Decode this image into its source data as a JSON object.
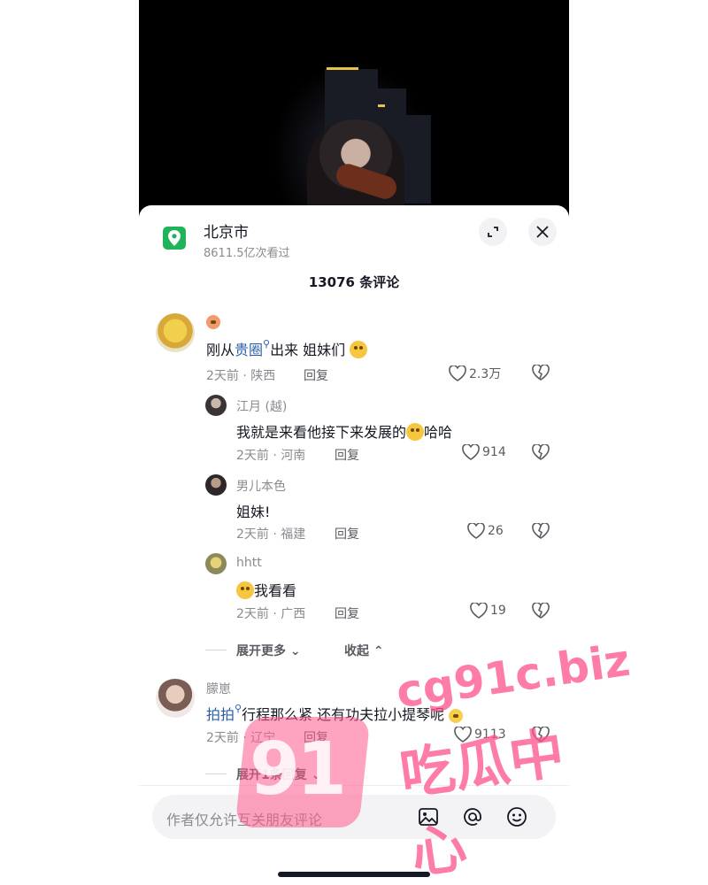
{
  "location": {
    "title": "北京市",
    "views": "8611.5亿次看过"
  },
  "comments_header": "13076 条评论",
  "comments": [
    {
      "name": "",
      "text_prefix": "刚从",
      "text_link": "贵圈",
      "text_suffix": "出来 姐妹们",
      "meta": "2天前 · 陕西",
      "reply": "回复",
      "likes": "2.3万"
    },
    {
      "name": "江月 (越)",
      "text": "我就是来看他接下来发展的",
      "text_after": "哈哈",
      "meta": "2天前 · 河南",
      "reply": "回复",
      "likes": "914"
    },
    {
      "name": "男儿本色",
      "text": "姐妹!",
      "meta": "2天前 · 福建",
      "reply": "回复",
      "likes": "26"
    },
    {
      "name": "hhtt",
      "text": "我看看",
      "meta": "2天前 · 广西",
      "reply": "回复",
      "likes": "19"
    },
    {
      "name": "朦崽",
      "text_link": "拍拍",
      "text_suffix": "行程那么紧 还有功夫拉小提琴呢",
      "meta": "2天前 · 辽宁",
      "reply": "回复",
      "likes": "9113"
    }
  ],
  "expand_more": "展开更多",
  "collapse": "收起",
  "expand_one": "展开1条回复",
  "input_placeholder": "作者仅允许互关朋友评论",
  "watermark": {
    "top": "cg91c.biz",
    "bottom": "吃瓜中心",
    "logo": "91"
  },
  "colors": {
    "accent_green": "#20b35a",
    "link_blue": "#2b5ea6"
  }
}
